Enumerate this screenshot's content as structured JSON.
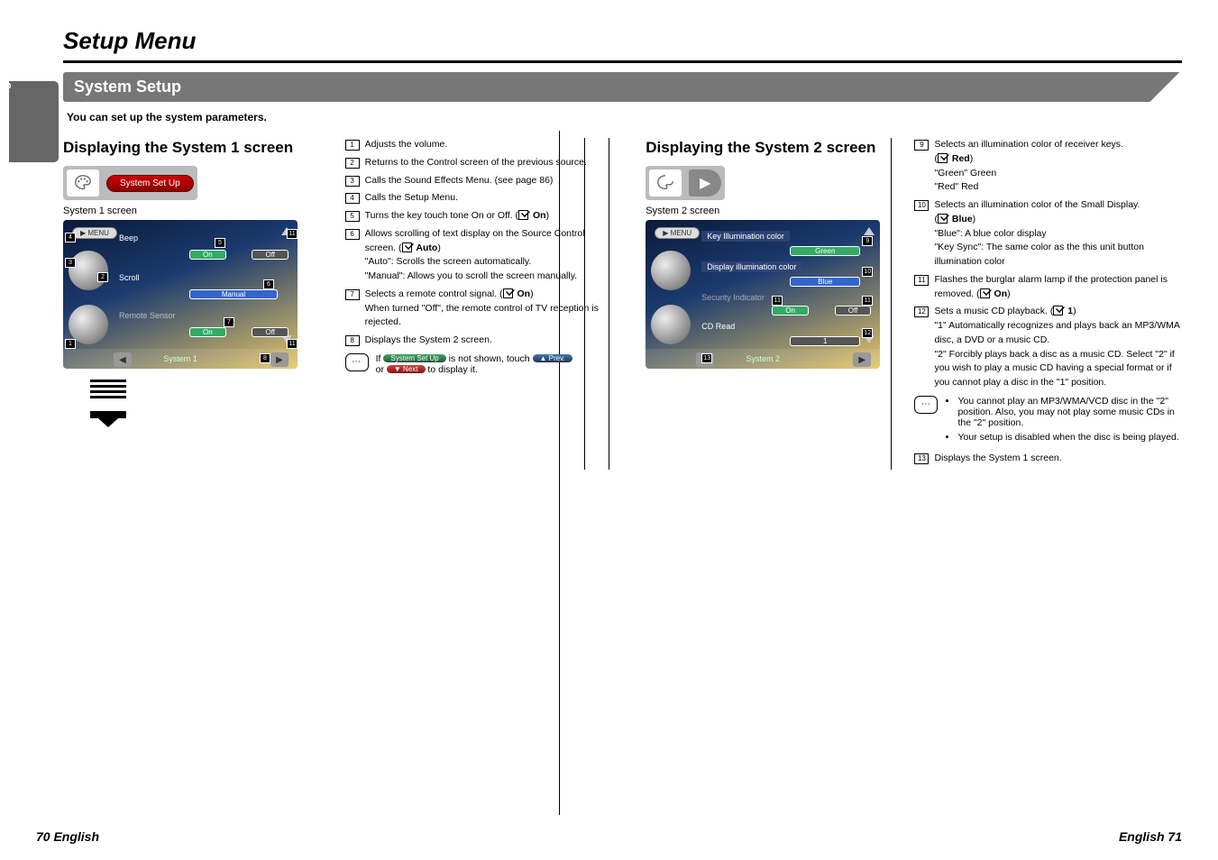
{
  "title": "Setup Menu",
  "lang_tab": "English",
  "section": "System Setup",
  "subtitle": "You can set up the system parameters.",
  "left": {
    "heading": "Displaying the System 1 screen",
    "pill_button": "System Set Up",
    "caption": "System 1 screen",
    "screen": {
      "menu": "▶ MENU",
      "r1_label": "Beep",
      "r1_on": "On",
      "r1_off": "Off",
      "r2_label": "Scroll",
      "r2_val": "Manual",
      "r3_label": "Remote Sensor",
      "r3_on": "On",
      "r3_off": "Off",
      "footer": "System 1"
    }
  },
  "leftlist": {
    "i1": "Adjusts the volume.",
    "i2": "Returns to the Control screen of the previous source.",
    "i3": "Calls the Sound Effects Menu. (see page 86)",
    "i4": "Calls the Setup Menu.",
    "i5a": "Turns the key touch tone On or Off. (",
    "i5b": "On",
    "i5c": ")",
    "i6a": "Allows scrolling of text display on the Source Control screen. (",
    "i6b": "Auto",
    "i6c": ")",
    "i6d": "\"Auto\":    Scrolls the screen automatically.",
    "i6e": "\"Manual\": Allows you to scroll the screen manually.",
    "i7a": "Selects a remote control signal. (",
    "i7b": "On",
    "i7c": ")",
    "i7d": "When turned \"Off\", the remote control of TV reception is rejected.",
    "i8": "Displays the System 2 screen.",
    "note_a": "If ",
    "note_pill1": "System Set Up",
    "note_b": " is not shown, touch ",
    "note_pill2": "▲ Prev.",
    "note_c": "or ",
    "note_pill3": "▼ Next",
    "note_d": " to display it."
  },
  "right": {
    "heading": "Displaying the System 2 screen",
    "caption": "System 2 screen",
    "screen": {
      "menu": "▶ MENU",
      "r1_label": "Key Illumination color",
      "r1_val": "Green",
      "r2_label": "Display illumination color",
      "r2_val": "Blue",
      "r3_label": "Security Indicator",
      "r3_on": "On",
      "r3_off": "Off",
      "r4_label": "CD Read",
      "r4_val": "1",
      "footer": "System 2"
    }
  },
  "rightlist": {
    "i9a": "Selects an illumination color of receiver keys.",
    "i9b": "(",
    "i9c": "Red",
    "i9d": ")",
    "i9e": "\"Green\"   Green",
    "i9f": "\"Red\"      Red",
    "i10a": "Selects an illumination color of the Small Display.",
    "i10b": "(",
    "i10c": "Blue",
    "i10d": ")",
    "i10e": "\"Blue\":       A blue color display",
    "i10f": "\"Key Sync\": The same color as the this unit button illumination color",
    "i11a": "Flashes the burglar alarm lamp if the protection panel is removed. (",
    "i11b": "On",
    "i11c": ")",
    "i12a": "Sets a music CD playback. (",
    "i12b": "1",
    "i12c": ")",
    "i12d": "\"1\"   Automatically recognizes and plays back an MP3/WMA disc, a DVD or a music CD.",
    "i12e": "\"2\"   Forcibly plays back a disc as a music CD. Select \"2\" if you wish to play a music CD having a special format or if you cannot play a disc in the \"1\" position.",
    "note1": "You cannot play an MP3/WMA/VCD disc in the \"2\" position.  Also, you may not play some music CDs in the \"2\" position.",
    "note2": "Your setup is disabled when the disc is being played.",
    "i13": "Displays the System 1 screen."
  },
  "footer_left": "70 English",
  "footer_right": "English 71"
}
